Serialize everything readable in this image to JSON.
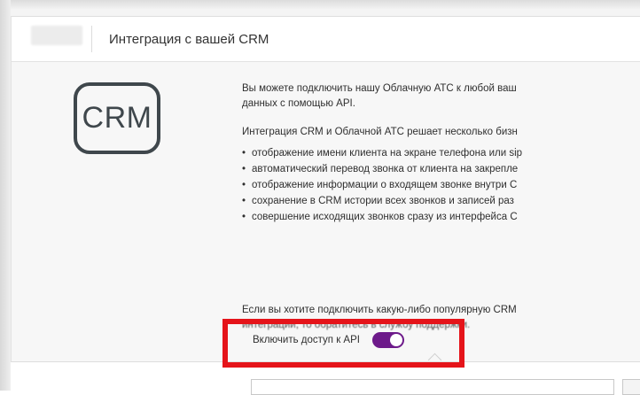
{
  "header": {
    "title": "Интеграция с вашей CRM"
  },
  "logo": {
    "text": "CRM",
    "icon": "crm-logo-icon",
    "color": "#3f474c"
  },
  "content": {
    "intro_line1": "Вы можете подключить нашу Облачную АТС к любой ваш",
    "intro_line2": "данных с помощью API.",
    "benefits_intro": "Интеграция CRM и Облачной АТС решает несколько бизн",
    "bullets": [
      "отображение имени клиента на экране телефона или sip",
      "автоматический перевод звонка от клиента на закрепле",
      "отображение информации о входящем звонке внутри С",
      "сохранение в CRM истории всех звонков и записей раз",
      "совершение исходящих звонков сразу из интерфейса С"
    ],
    "popular_line1": "Если вы хотите подключить какую-либо популярную CRM",
    "popular_line2": "интеграций, то обратитесь в службу поддержки."
  },
  "api_access": {
    "label": "Включить доступ к API",
    "enabled": true,
    "toggle_color": "#6d1a8a"
  },
  "highlight": {
    "color": "#e5141a"
  }
}
